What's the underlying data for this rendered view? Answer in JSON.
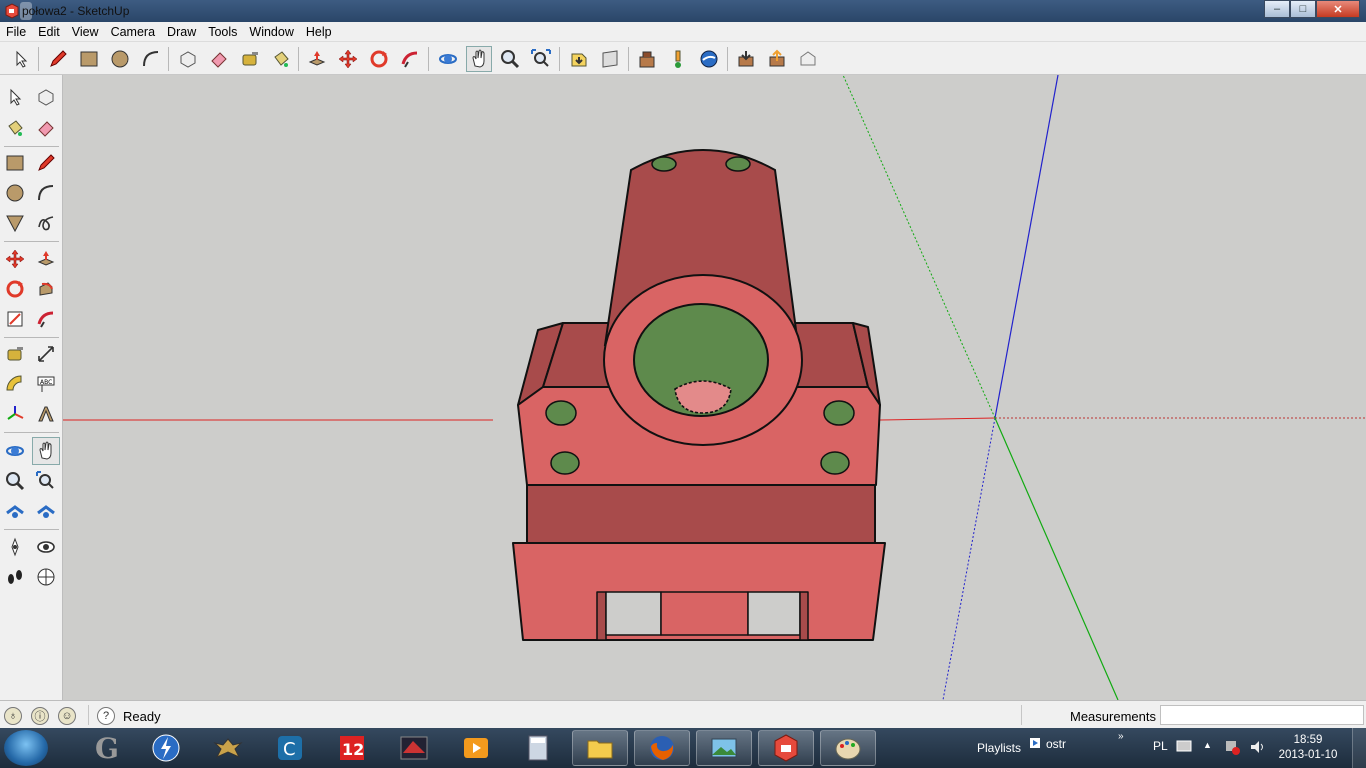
{
  "window": {
    "title": "połowa2 - SketchUp",
    "minimize": "–",
    "maximize": "□",
    "close": "✕"
  },
  "menu": {
    "items": [
      "File",
      "Edit",
      "View",
      "Camera",
      "Draw",
      "Tools",
      "Window",
      "Help"
    ]
  },
  "toolbar": {
    "icons": [
      "select-icon",
      "pencil-icon",
      "rectangle-icon",
      "circle-icon",
      "arc-icon",
      "make-component-icon",
      "eraser-icon",
      "tape-measure-icon",
      "paint-bucket-icon",
      "push-pull-icon",
      "move-icon",
      "rotate-icon",
      "follow-me-icon",
      "orbit-icon",
      "pan-icon",
      "zoom-icon",
      "zoom-extents-icon",
      "previous-view-icon",
      "next-view-icon",
      "components-icon",
      "add-location-icon",
      "google-earth-icon",
      "get-models-icon",
      "share-model-icon",
      "share-component-icon"
    ]
  },
  "left_toolbar": {
    "icons": [
      "select-icon",
      "make-component-icon",
      "paint-bucket-icon",
      "eraser-icon",
      "rectangle-icon",
      "pencil-icon",
      "circle-icon",
      "arc-icon",
      "polygon-icon",
      "freehand-icon",
      "move-icon",
      "push-pull-icon",
      "rotate-icon",
      "follow-me-icon",
      "scale-icon",
      "offset-icon",
      "tape-measure-icon",
      "dimension-icon",
      "protractor-icon",
      "text-icon",
      "axes-icon",
      "3d-text-icon",
      "orbit-icon",
      "pan-icon",
      "zoom-icon",
      "zoom-window-icon",
      "zoom-extents-icon",
      "previous-icon",
      "position-camera-icon",
      "look-around-icon",
      "walk-icon",
      "section-plane-icon"
    ]
  },
  "status": {
    "text": "Ready",
    "measurements_label": "Measurements",
    "measurements_value": ""
  },
  "taskbar": {
    "playlists_label": "Playlists",
    "playlist_name": "ostr",
    "language": "PL",
    "time": "18:59",
    "date": "2013-01-10",
    "apps": [
      "gimp-icon",
      "winamp-icon",
      "witcher-icon",
      "ccleaner-icon",
      "ncore-12-icon",
      "game-icon",
      "media-player-icon",
      "calculator-icon",
      "file-explorer-icon",
      "firefox-icon",
      "photo-viewer-icon",
      "sketchup-icon",
      "paint-icon"
    ]
  },
  "colors": {
    "model_face": "#d96464",
    "model_shade": "#a84b4b",
    "hole_green": "#5e8a4c",
    "axis_red": "#d22",
    "axis_green": "#1a1",
    "axis_blue": "#22c",
    "viewport_bg": "#cdcdcb"
  }
}
